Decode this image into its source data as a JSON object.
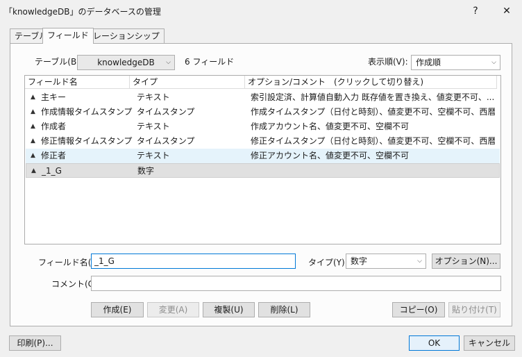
{
  "window": {
    "title": "「knowledgeDB」のデータベースの管理",
    "help": "?",
    "close": "✕"
  },
  "tabs": [
    {
      "label": "テーブル"
    },
    {
      "label": "フィールド"
    },
    {
      "label": "リレーションシップ"
    }
  ],
  "toolbar": {
    "table_label": "テーブル(B):",
    "table_value": "knowledgeDB",
    "field_count": "6 フィールド",
    "order_label": "表示順(V):",
    "order_value": "作成順"
  },
  "columns": {
    "name": "フィールド名",
    "type": "タイプ",
    "options": "オプション/コメント　(クリックして切り替え)"
  },
  "fields": [
    {
      "name": "主キー",
      "type": "テキスト",
      "options": "索引設定済、計算値自動入力  既存値を置き換え、値変更不可、..."
    },
    {
      "name": "作成情報タイムスタンプ",
      "type": "タイムスタンプ",
      "options": "作成タイムスタンプ（日付と時刻）、値変更不可、空欄不可、西暦..."
    },
    {
      "name": "作成者",
      "type": "テキスト",
      "options": "作成アカウント名、値変更不可、空欄不可"
    },
    {
      "name": "修正情報タイムスタンプ",
      "type": "タイムスタンプ",
      "options": "修正タイムスタンプ（日付と時刻）、値変更不可、空欄不可、西暦..."
    },
    {
      "name": "修正者",
      "type": "テキスト",
      "options": "修正アカウント名、値変更不可、空欄不可"
    },
    {
      "name": "_1_G",
      "type": "数字",
      "options": ""
    }
  ],
  "editor": {
    "name_label": "フィールド名(F):",
    "name_value": "_1_G",
    "type_label": "タイプ(Y):",
    "type_value": "数字",
    "options_button": "オプション(N)...",
    "comment_label": "コメント(C):",
    "comment_value": ""
  },
  "actions": {
    "create": "作成(E)",
    "change": "変更(A)",
    "duplicate": "複製(U)",
    "delete": "削除(L)",
    "copy": "コピー(O)",
    "paste": "貼り付け(T)"
  },
  "footer": {
    "print": "印刷(P)...",
    "ok": "OK",
    "cancel": "キャンセル"
  }
}
